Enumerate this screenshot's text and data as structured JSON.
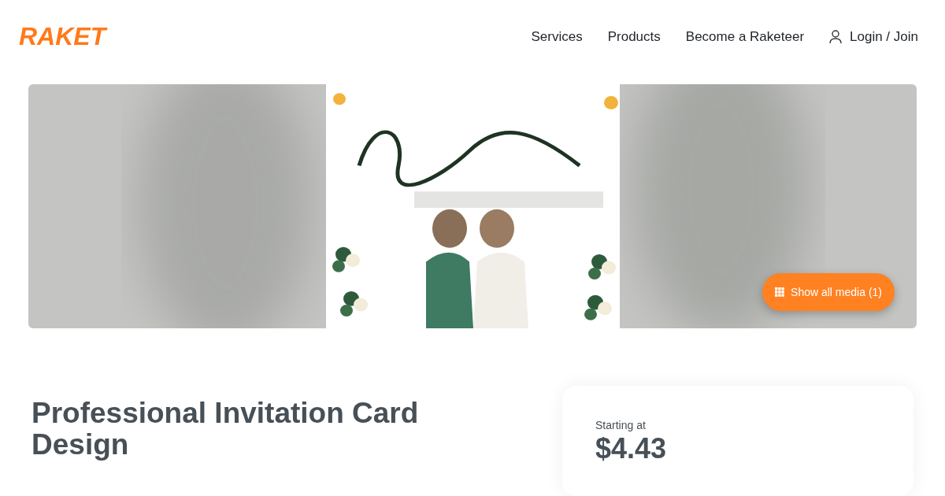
{
  "header": {
    "logo": "RAKET",
    "nav": [
      {
        "label": "Services",
        "kind": "link"
      },
      {
        "label": "Products",
        "kind": "link"
      },
      {
        "label": "Become a Raketeer",
        "kind": "link"
      },
      {
        "label": "Login / Join",
        "kind": "login"
      }
    ]
  },
  "hero": {
    "show_media_button": "Show all media (1)"
  },
  "listing": {
    "title": "Professional Invitation Card Design"
  },
  "pricing": {
    "label": "Starting at",
    "price": "$4.43"
  }
}
